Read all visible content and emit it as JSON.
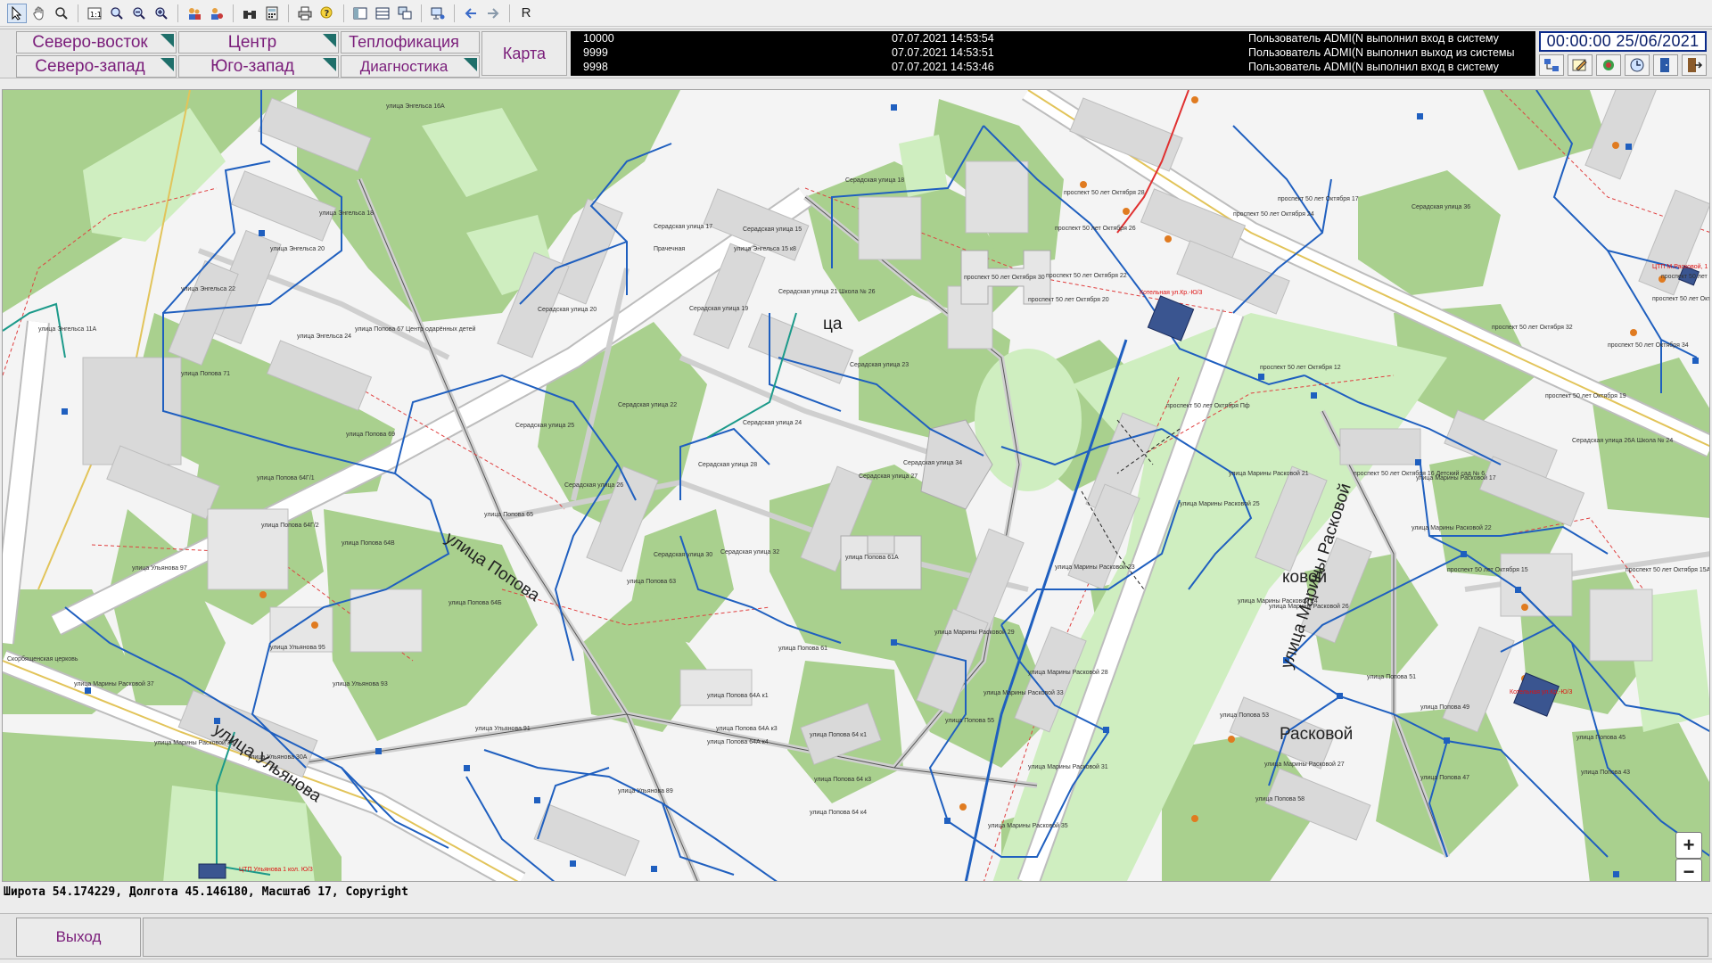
{
  "toolbar": {
    "letter_button": "R"
  },
  "nav": {
    "northeast": "Северо-восток",
    "center": "Центр",
    "heating": "Теплофикация",
    "northwest": "Северо-запад",
    "southwest": "Юго-запад",
    "diagnostics": "Диагностика",
    "map": "Карта"
  },
  "log": [
    {
      "id": "10000",
      "time": "07.07.2021 14:53:54",
      "message": "Пользователь ADMI(N выполнил вход в систему"
    },
    {
      "id": "9999",
      "time": "07.07.2021 14:53:51",
      "message": "Пользователь ADMI(N выполнил выход из системы"
    },
    {
      "id": "9998",
      "time": "07.07.2021 14:53:46",
      "message": "Пользователь ADMI(N выполнил вход в систему"
    }
  ],
  "clock": "00:00:00  25/06/2021",
  "map": {
    "streets": {
      "popova": "улица Попова",
      "ulyanova": "улица Ульянова",
      "raskovoy": "улица Марины Расковой",
      "raskovoy_fragment1": "ковой",
      "raskovoy_fragment2": "Расковой",
      "center_fragment": "ца"
    },
    "labels": [
      "улица Энгельса 18",
      "улица Энгельса 20",
      "улица Энгельса 22",
      "улица Энгельса 24",
      "улица Энгельса 16А",
      "улица Энгельса 11А",
      "улица Попова 71",
      "улица Попова 69",
      "улица Попова 65",
      "улица Попова 64Г/1",
      "улица Попова 64Г/2",
      "улица Попова 64В",
      "улица Попова 64Б",
      "улица Попова 67 Центр одарённых детей",
      "улица Ульянова 97",
      "улица Ульянова 95",
      "улица Ульянова 93",
      "улица Ульянова 91",
      "улица Ульянова 89",
      "улица Ульянова 30А",
      "улица Попова 63",
      "улица Попова 61",
      "улица Попова 61А",
      "улица Попова 64А к1",
      "улица Попова 64А к3",
      "улица Попова 64А к4",
      "улица Попова 64 к1",
      "улица Попова 64 к3",
      "улица Попова 64 к4",
      "улица Попова 55",
      "улица Попова 53",
      "улица Попова 51",
      "улица Попова 49",
      "улица Попова 47",
      "улица Попова 45",
      "улица Попова 43",
      "улица Попова 58",
      "Серадская улица 15",
      "Серадская улица 17",
      "Серадская улица 18",
      "Серадская улица 19",
      "Серадская улица 20",
      "Серадская улица 21 Школа № 26",
      "Серадская улица 22",
      "Серадская улица 23",
      "Серадская улица 24",
      "Серадская улица 25",
      "Серадская улица 26",
      "Серадская улица 27",
      "Серадская улица 28",
      "Серадская улица 30",
      "Серадская улица 32",
      "Серадская улица 34",
      "Серадская улица 36",
      "Серадская улица 26А Школа № 24",
      "проспект 50 лет Октября 17",
      "проспект 50 лет Октября 18",
      "проспект 50 лет Октября 19",
      "проспект 50 лет Октября 20",
      "проспект 50 лет Октября 22",
      "проспект 50 лет Октября 24",
      "проспект 50 лет Октября 26",
      "проспект 50 лет Октября 28",
      "проспект 50 лет Октября 30",
      "проспект 50 лет Октября 32",
      "проспект 50 лет Октября 34",
      "проспект 50 лет Октября 13А",
      "проспект 50 лет Октября 15",
      "проспект 50 лет Октября 15А",
      "проспект 50 лет Октября 16 Детский сад № 6",
      "проспект 50 лет Октября 12",
      "проспект 50 лет Октября Пф",
      "улица Марины Расковой 17",
      "улица Марины Расковой 21",
      "улица Марины Расковой 22",
      "улица Марины Расковой 23",
      "улица Марины Расковой 24",
      "улица Марины Расковой 25",
      "улица Марины Расковой 26",
      "улица Марины Расковой 27",
      "улица Марины Расковой 28",
      "улица Марины Расковой 29",
      "улица Марины Расковой 31",
      "улица Марины Расковой 33",
      "улица Марины Расковой 35",
      "улица Марины Расковой 37",
      "улица Марины Расковой 39",
      "Скорбященская церковь",
      "Прачечная",
      "улица Энгельса 15 к8"
    ],
    "red_labels": [
      "Котельная ул.Кр.-Ю/3",
      "Котельная ул.Кр.-Ю/3",
      "ЦТП Ульянова 1 кол. Ю/3",
      "ЦТП М.Расковой, 1"
    ],
    "zoom_in": "+",
    "zoom_out": "−"
  },
  "status": "Широта 54.174229, Долгота 45.146180, Масштаб 17, Copyright",
  "bottom": {
    "exit": "Выход"
  },
  "colors": {
    "park_green": "#a9d08e",
    "light_green": "#cfeec0",
    "building": "#d9d9d9",
    "pipe_blue": "#1f5fbf",
    "pipe_teal": "#1c9a8a",
    "accent_purple": "#7a1d7a",
    "node_orange": "#e07b20"
  }
}
